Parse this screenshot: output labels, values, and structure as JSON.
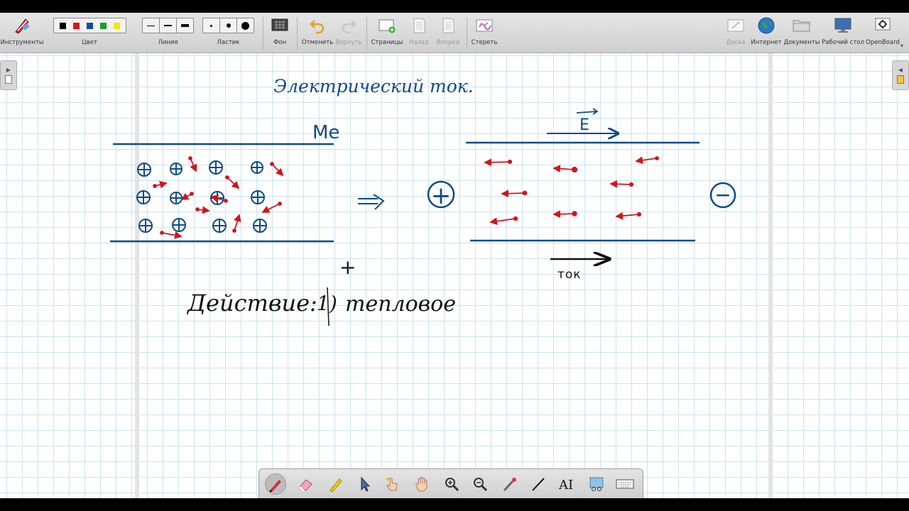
{
  "toolbar": {
    "tools_label": "Инструменты",
    "color_label": "Цвет",
    "line_label": "Линия",
    "eraser_label": "Ластик",
    "background_label": "Фон",
    "undo_label": "Отменить",
    "redo_label": "Вернуть",
    "pages_label": "Страницы",
    "back_label": "Назад",
    "forward_label": "Вперед",
    "erase_label": "Стереть",
    "board_label": "Доска",
    "internet_label": "Интернет",
    "documents_label": "Документы",
    "desktop_label": "Рабочий стол",
    "openboard_label": "OpenBoard",
    "colors": [
      "#000000",
      "#e01010",
      "#0e4f9a",
      "#14a02c",
      "#f3e600"
    ]
  },
  "board": {
    "title": "Электрический ток.",
    "metal_label": "Me",
    "field_label": "E",
    "current_label": "ток",
    "plus_mark": "+",
    "actions_text": "Действие:",
    "item_number": "1)",
    "item_text": "тепловое",
    "plus_terminal": "+",
    "minus_terminal": "−",
    "ink_blue": "#0e4a86",
    "ink_red": "#d0151b",
    "ink_black": "#111111"
  },
  "bottom_tools": [
    "pen-icon",
    "eraser-icon",
    "marker-icon",
    "selector-icon",
    "interactor-icon",
    "hand-icon",
    "zoom-in-icon",
    "zoom-out-icon",
    "laser-pointer-icon",
    "line-icon",
    "text-icon",
    "capture-icon",
    "keyboard-icon"
  ]
}
